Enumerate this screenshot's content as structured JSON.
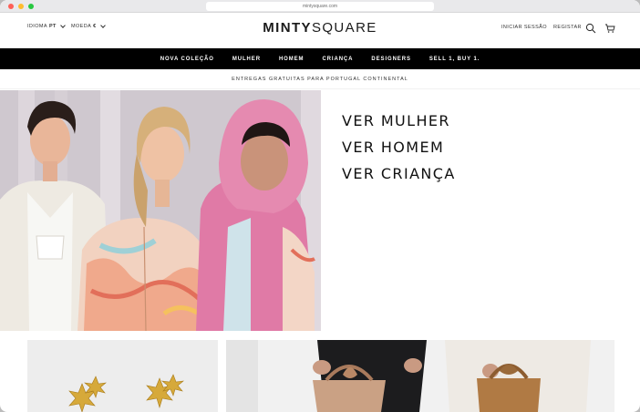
{
  "browser": {
    "url": "mintysquare.com"
  },
  "header": {
    "language_label": "IDIOMA",
    "language_value": "PT",
    "currency_label": "MOEDA",
    "currency_value": "€",
    "logo_bold": "MINTY",
    "logo_light": "SQUARE",
    "login": "INICIAR SESSÃO",
    "register": "REGISTAR",
    "search_icon": "search-icon",
    "cart_icon": "cart-icon"
  },
  "nav": {
    "items": [
      "NOVA COLEÇÃO",
      "MULHER",
      "HOMEM",
      "CRIANÇA",
      "DESIGNERS",
      "SELL 1, BUY 1."
    ]
  },
  "promo": {
    "text": "ENTREGAS GRATUITAS PARA PORTUGAL CONTINENTAL"
  },
  "hero": {
    "links": [
      "VER MULHER",
      "VER HOMEM",
      "VER CRIANÇA"
    ]
  },
  "colors": {
    "nav_bg": "#000000",
    "hood_pink": "#e07aa6"
  }
}
